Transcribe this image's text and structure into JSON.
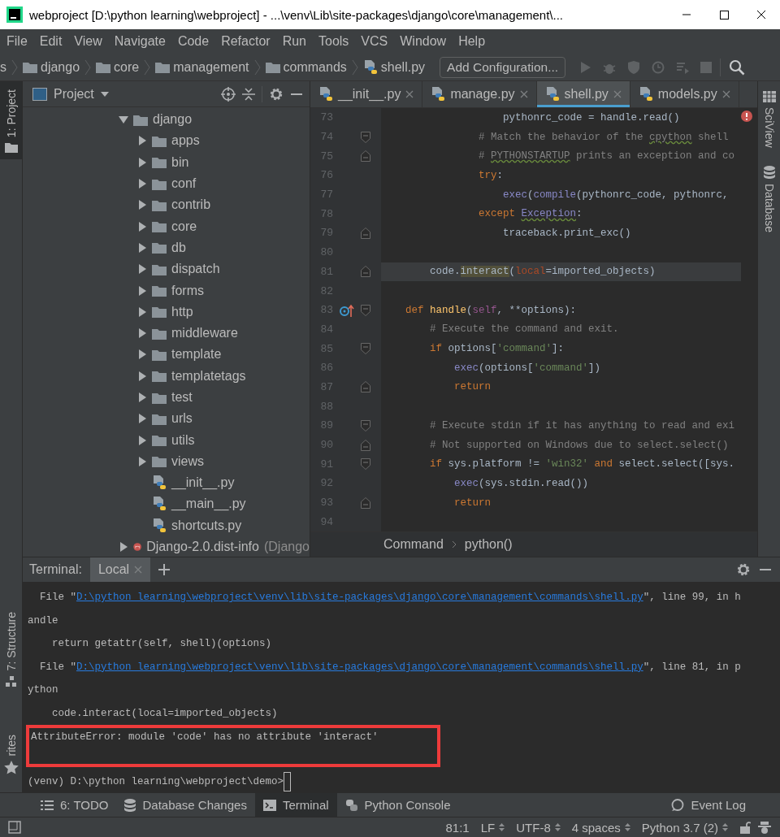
{
  "window": {
    "title": "webproject [D:\\python learning\\webproject] - ...\\venv\\Lib\\site-packages\\django\\core\\management\\..."
  },
  "menu": [
    "File",
    "Edit",
    "View",
    "Navigate",
    "Code",
    "Refactor",
    "Run",
    "Tools",
    "VCS",
    "Window",
    "Help"
  ],
  "navbar": {
    "breadcrumbs": [
      {
        "label": "s",
        "kind": "text"
      },
      {
        "label": "django",
        "kind": "folder"
      },
      {
        "label": "core",
        "kind": "folder"
      },
      {
        "label": "management",
        "kind": "folder"
      },
      {
        "label": "commands",
        "kind": "folder"
      },
      {
        "label": "shell.py",
        "kind": "python"
      }
    ],
    "run_config": "Add Configuration..."
  },
  "left_strip": {
    "top": [
      {
        "label": "1: Project",
        "kind": "project",
        "selected": true
      }
    ],
    "bottom": [
      {
        "label": "7: Structure",
        "kind": "structure",
        "selected": false
      },
      {
        "label": "rites",
        "kind": "favorites",
        "selected": false
      }
    ]
  },
  "project": {
    "title": "Project",
    "tree": [
      {
        "label": "django",
        "kind": "folder",
        "expanded": true,
        "children": [
          {
            "label": "apps",
            "kind": "folder",
            "expanded": false
          },
          {
            "label": "bin",
            "kind": "folder",
            "expanded": false
          },
          {
            "label": "conf",
            "kind": "folder",
            "expanded": false
          },
          {
            "label": "contrib",
            "kind": "folder",
            "expanded": false
          },
          {
            "label": "core",
            "kind": "folder",
            "expanded": false
          },
          {
            "label": "db",
            "kind": "folder",
            "expanded": false
          },
          {
            "label": "dispatch",
            "kind": "folder",
            "expanded": false
          },
          {
            "label": "forms",
            "kind": "folder",
            "expanded": false
          },
          {
            "label": "http",
            "kind": "folder",
            "expanded": false
          },
          {
            "label": "middleware",
            "kind": "folder",
            "expanded": false
          },
          {
            "label": "template",
            "kind": "folder",
            "expanded": false
          },
          {
            "label": "templatetags",
            "kind": "folder",
            "expanded": false
          },
          {
            "label": "test",
            "kind": "folder",
            "expanded": false
          },
          {
            "label": "urls",
            "kind": "folder",
            "expanded": false
          },
          {
            "label": "utils",
            "kind": "folder",
            "expanded": false
          },
          {
            "label": "views",
            "kind": "folder",
            "expanded": false
          },
          {
            "label": "__init__.py",
            "kind": "python"
          },
          {
            "label": "__main__.py",
            "kind": "python"
          },
          {
            "label": "shortcuts.py",
            "kind": "python"
          }
        ]
      },
      {
        "label": "Django-2.0.dist-info",
        "kind": "library",
        "expanded": false,
        "note": "(Django"
      }
    ]
  },
  "editor": {
    "tabs": [
      {
        "label": "__init__.py",
        "selected": false
      },
      {
        "label": "manage.py",
        "selected": false
      },
      {
        "label": "shell.py",
        "selected": true
      },
      {
        "label": "models.py",
        "selected": false
      }
    ],
    "lines": [
      {
        "number": "73",
        "tokens": [
          {
            "text": "                    pythonrc_code = handle.read()",
            "kind": "plain"
          }
        ]
      },
      {
        "number": "74",
        "fold_start": true,
        "tokens": [
          {
            "text": "                # Match the behavior of the ",
            "kind": "comment"
          },
          {
            "text": "cpython",
            "kind": "comment",
            "squiggle": true
          },
          {
            "text": " shell",
            "kind": "comment"
          }
        ]
      },
      {
        "number": "75",
        "fold_end": true,
        "tokens": [
          {
            "text": "                # ",
            "kind": "comment"
          },
          {
            "text": "PYTHONSTARTUP",
            "kind": "comment",
            "squiggle": true
          },
          {
            "text": " prints an exception and co",
            "kind": "comment"
          }
        ]
      },
      {
        "number": "76",
        "tokens": [
          {
            "text": "                try",
            "kind": "keyword"
          },
          {
            "text": ":",
            "kind": "plain"
          }
        ]
      },
      {
        "number": "77",
        "tokens": [
          {
            "text": "                    exec",
            "kind": "builtin"
          },
          {
            "text": "(",
            "kind": "plain"
          },
          {
            "text": "compile",
            "kind": "builtin"
          },
          {
            "text": "(pythonrc_code, pythonrc,",
            "kind": "plain"
          }
        ]
      },
      {
        "number": "78",
        "tokens": [
          {
            "text": "                except ",
            "kind": "keyword"
          },
          {
            "text": "Exception",
            "kind": "builtin",
            "squiggle": true
          },
          {
            "text": ":",
            "kind": "plain"
          }
        ]
      },
      {
        "number": "79",
        "fold_end": true,
        "tokens": [
          {
            "text": "                    traceback.print_exc()",
            "kind": "plain"
          }
        ]
      },
      {
        "number": "80"
      },
      {
        "number": "81",
        "fold_end": true,
        "current": true,
        "tokens": [
          {
            "text": "        code.",
            "kind": "plain"
          },
          {
            "text": "interact",
            "kind": "plain",
            "highlight": true
          },
          {
            "text": "(",
            "kind": "plain"
          },
          {
            "text": "local",
            "kind": "param"
          },
          {
            "text": "=imported_objects)",
            "kind": "plain"
          }
        ]
      },
      {
        "number": "82"
      },
      {
        "number": "83",
        "fold_start": true,
        "overrides": true,
        "tokens": [
          {
            "text": "    def ",
            "kind": "keyword"
          },
          {
            "text": "handle",
            "kind": "function"
          },
          {
            "text": "(",
            "kind": "plain"
          },
          {
            "text": "self",
            "kind": "self"
          },
          {
            "text": ", **options):",
            "kind": "plain"
          }
        ]
      },
      {
        "number": "84",
        "tokens": [
          {
            "text": "        # Execute the command and exit.",
            "kind": "comment"
          }
        ]
      },
      {
        "number": "85",
        "fold_start": true,
        "tokens": [
          {
            "text": "        if",
            "kind": "keyword"
          },
          {
            "text": " options[",
            "kind": "plain"
          },
          {
            "text": "'command'",
            "kind": "string"
          },
          {
            "text": "]:",
            "kind": "plain"
          }
        ]
      },
      {
        "number": "86",
        "tokens": [
          {
            "text": "            exec",
            "kind": "builtin"
          },
          {
            "text": "(options[",
            "kind": "plain"
          },
          {
            "text": "'command'",
            "kind": "string"
          },
          {
            "text": "])",
            "kind": "plain"
          }
        ]
      },
      {
        "number": "87",
        "fold_end": true,
        "tokens": [
          {
            "text": "            return",
            "kind": "keyword"
          }
        ]
      },
      {
        "number": "88"
      },
      {
        "number": "89",
        "fold_start": true,
        "tokens": [
          {
            "text": "        # Execute stdin if it has anything to read and exi",
            "kind": "comment"
          }
        ]
      },
      {
        "number": "90",
        "fold_end": true,
        "tokens": [
          {
            "text": "        # Not supported on Windows due to select.select()",
            "kind": "comment"
          }
        ]
      },
      {
        "number": "91",
        "fold_start": true,
        "tokens": [
          {
            "text": "        if",
            "kind": "keyword"
          },
          {
            "text": " sys.platform != ",
            "kind": "plain"
          },
          {
            "text": "'win32'",
            "kind": "string"
          },
          {
            "text": " and",
            "kind": "keyword"
          },
          {
            "text": " select.select([sys.",
            "kind": "plain"
          }
        ]
      },
      {
        "number": "92",
        "tokens": [
          {
            "text": "            exec",
            "kind": "builtin"
          },
          {
            "text": "(sys.stdin.read())",
            "kind": "plain"
          }
        ]
      },
      {
        "number": "93",
        "fold_end": true,
        "tokens": [
          {
            "text": "            return",
            "kind": "keyword"
          }
        ]
      },
      {
        "number": "94"
      }
    ],
    "breadcrumbs": [
      "Command",
      "python()"
    ]
  },
  "right_strip": [
    {
      "label": "SciView",
      "kind": "sciview"
    },
    {
      "label": "Database",
      "kind": "database"
    }
  ],
  "terminal": {
    "title": "Terminal:",
    "tabs": [
      {
        "label": "Local",
        "selected": true
      }
    ],
    "lines": [
      {
        "segments": [
          {
            "text": "  File \"",
            "kind": "plain"
          },
          {
            "text": "D:\\python learning\\webproject\\venv\\lib\\site-packages\\django\\core\\management\\commands\\shell.py",
            "kind": "link"
          },
          {
            "text": "\", line 99, in h",
            "kind": "plain"
          }
        ]
      },
      {
        "segments": [
          {
            "text": "andle",
            "kind": "plain"
          }
        ]
      },
      {
        "segments": [
          {
            "text": "    return getattr(self, shell)(options)",
            "kind": "plain"
          }
        ]
      },
      {
        "segments": [
          {
            "text": "  File \"",
            "kind": "plain"
          },
          {
            "text": "D:\\python learning\\webproject\\venv\\lib\\site-packages\\django\\core\\management\\commands\\shell.py",
            "kind": "link"
          },
          {
            "text": "\", line 81, in p",
            "kind": "plain"
          }
        ]
      },
      {
        "segments": [
          {
            "text": "ython",
            "kind": "plain"
          }
        ]
      },
      {
        "segments": [
          {
            "text": "    code.interact(local=imported_objects)",
            "kind": "plain"
          }
        ]
      },
      {
        "highlighted": true,
        "segments": [
          {
            "text": "AttributeError: module 'code' has no attribute 'interact'",
            "kind": "plain"
          }
        ]
      }
    ],
    "prompt": "(venv) D:\\python learning\\webproject\\demo>"
  },
  "tool_tabs": [
    {
      "label": "6: TODO",
      "kind": "todo",
      "selected": false
    },
    {
      "label": "Database Changes",
      "kind": "database",
      "selected": false
    },
    {
      "label": "Terminal",
      "kind": "terminal",
      "selected": true
    },
    {
      "label": "Python Console",
      "kind": "python",
      "selected": false
    }
  ],
  "event_log": "Event Log",
  "status_bar": [
    {
      "text": "81:1",
      "dropdown": false
    },
    {
      "text": "LF",
      "dropdown": true
    },
    {
      "text": "UTF-8",
      "dropdown": true
    },
    {
      "text": "4 spaces",
      "dropdown": true
    },
    {
      "text": "Python 3.7 (2)",
      "dropdown": true
    }
  ]
}
